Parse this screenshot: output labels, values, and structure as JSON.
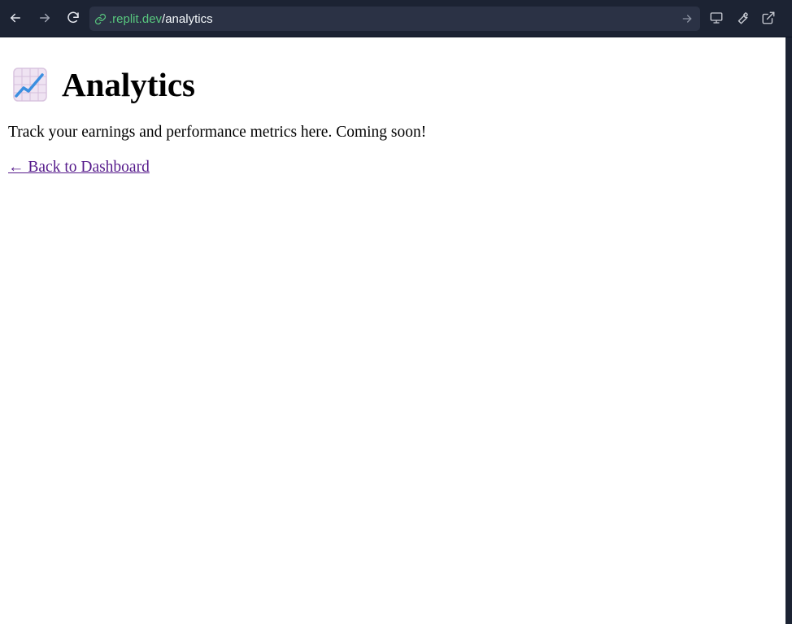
{
  "browser": {
    "url_host": ".replit.dev",
    "url_path": "/analytics",
    "icons": {
      "back": "arrow-left-icon",
      "forward": "arrow-right-icon",
      "reload": "reload-icon",
      "link": "link-icon",
      "go": "arrow-right-icon",
      "devices": "monitor-icon",
      "devtools": "wrench-icon",
      "open_new": "external-link-icon"
    },
    "colors": {
      "toolbar_bg": "#1c2333",
      "urlbar_bg": "#2b3245",
      "host_green": "#58c77e"
    }
  },
  "page": {
    "emoji": "chart-increasing-emoji",
    "title": "Analytics",
    "description": "Track your earnings and performance metrics here. Coming soon!",
    "back_link": "← Back to Dashboard",
    "link_color": "#551a8b"
  }
}
